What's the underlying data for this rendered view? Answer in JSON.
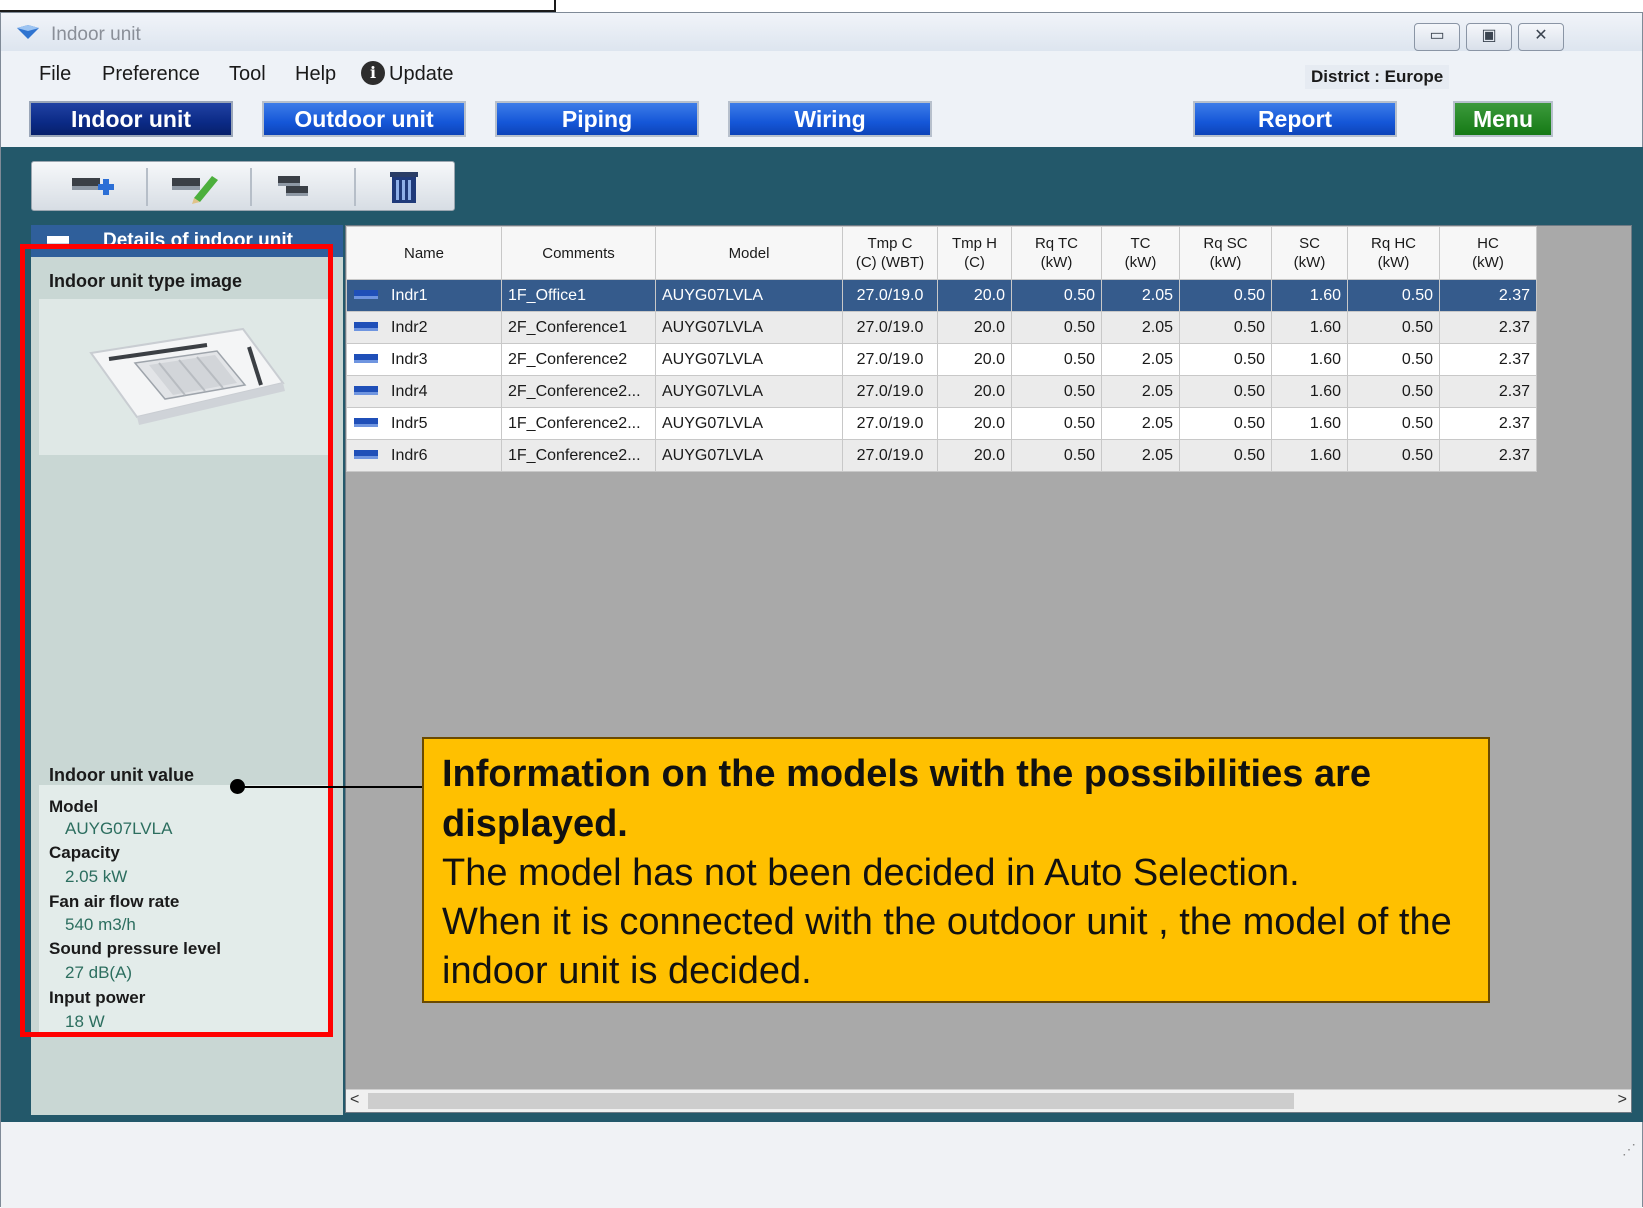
{
  "window": {
    "title": "Indoor unit",
    "controls": {
      "minimize": "▭",
      "maximize": "▣",
      "close": "✕"
    }
  },
  "menubar": {
    "items": [
      "File",
      "Preference",
      "Tool",
      "Help"
    ],
    "update_label": "Update",
    "update_icon": "i",
    "district": "District : Europe"
  },
  "nav": {
    "indoor": "Indoor unit",
    "outdoor": "Outdoor unit",
    "piping": "Piping",
    "wiring": "Wiring",
    "report": "Report",
    "menu": "Menu"
  },
  "toolbar": {
    "buttons": [
      "add-unit-icon",
      "edit-unit-icon",
      "copy-unit-icon",
      "delete-icon"
    ]
  },
  "details_panel": {
    "header": "Details of indoor unit",
    "type_image_label": "Indoor unit type image",
    "value_label": "Indoor unit value",
    "model_label": "Model",
    "model_value": "AUYG07LVLA",
    "capacity_label": "Capacity",
    "capacity_value": "2.05 kW",
    "airflow_label": "Fan air flow rate",
    "airflow_value": "540 m3/h",
    "sound_label": "Sound pressure level",
    "sound_value": "27 dB(A)",
    "power_label": "Input power",
    "power_value": "18 W"
  },
  "grid": {
    "columns": [
      "Name",
      "Comments",
      "Model",
      "Tmp C\n(C) (WBT)",
      "Tmp H\n(C)",
      "Rq TC\n(kW)",
      "TC\n(kW)",
      "Rq SC\n(kW)",
      "SC\n(kW)",
      "Rq HC\n(kW)",
      "HC\n(kW)"
    ],
    "rows": [
      {
        "name": "Indr1",
        "comments": "1F_Office1",
        "model": "AUYG07LVLA",
        "tmpc": "27.0/19.0",
        "tmph": "20.0",
        "rqtc": "0.50",
        "tc": "2.05",
        "rqsc": "0.50",
        "sc": "1.60",
        "rqhc": "0.50",
        "hc": "2.37"
      },
      {
        "name": "Indr2",
        "comments": "2F_Conference1",
        "model": "AUYG07LVLA",
        "tmpc": "27.0/19.0",
        "tmph": "20.0",
        "rqtc": "0.50",
        "tc": "2.05",
        "rqsc": "0.50",
        "sc": "1.60",
        "rqhc": "0.50",
        "hc": "2.37"
      },
      {
        "name": "Indr3",
        "comments": "2F_Conference2",
        "model": "AUYG07LVLA",
        "tmpc": "27.0/19.0",
        "tmph": "20.0",
        "rqtc": "0.50",
        "tc": "2.05",
        "rqsc": "0.50",
        "sc": "1.60",
        "rqhc": "0.50",
        "hc": "2.37"
      },
      {
        "name": "Indr4",
        "comments": "2F_Conference2...",
        "model": "AUYG07LVLA",
        "tmpc": "27.0/19.0",
        "tmph": "20.0",
        "rqtc": "0.50",
        "tc": "2.05",
        "rqsc": "0.50",
        "sc": "1.60",
        "rqhc": "0.50",
        "hc": "2.37"
      },
      {
        "name": "Indr5",
        "comments": "1F_Conference2...",
        "model": "AUYG07LVLA",
        "tmpc": "27.0/19.0",
        "tmph": "20.0",
        "rqtc": "0.50",
        "tc": "2.05",
        "rqsc": "0.50",
        "sc": "1.60",
        "rqhc": "0.50",
        "hc": "2.37"
      },
      {
        "name": "Indr6",
        "comments": "1F_Conference2...",
        "model": "AUYG07LVLA",
        "tmpc": "27.0/19.0",
        "tmph": "20.0",
        "rqtc": "0.50",
        "tc": "2.05",
        "rqsc": "0.50",
        "sc": "1.60",
        "rqhc": "0.50",
        "hc": "2.37"
      }
    ],
    "selected_row": 0,
    "scroll_left": "<",
    "scroll_right": ">"
  },
  "callout": {
    "headline": "Information on the models  with the possibilities are displayed.",
    "line1": "The model has not been decided in Auto Selection.",
    "line2": "When it is connected with the outdoor unit , the model of the indoor unit is decided."
  },
  "colors": {
    "workarea": "#23586a",
    "nav_button": "#1557d8",
    "nav_active": "#0b2a86",
    "menu_button": "#157a15",
    "selected_row": "#355b8c",
    "callout": "#ffc000",
    "highlight_box": "#ff0000"
  }
}
